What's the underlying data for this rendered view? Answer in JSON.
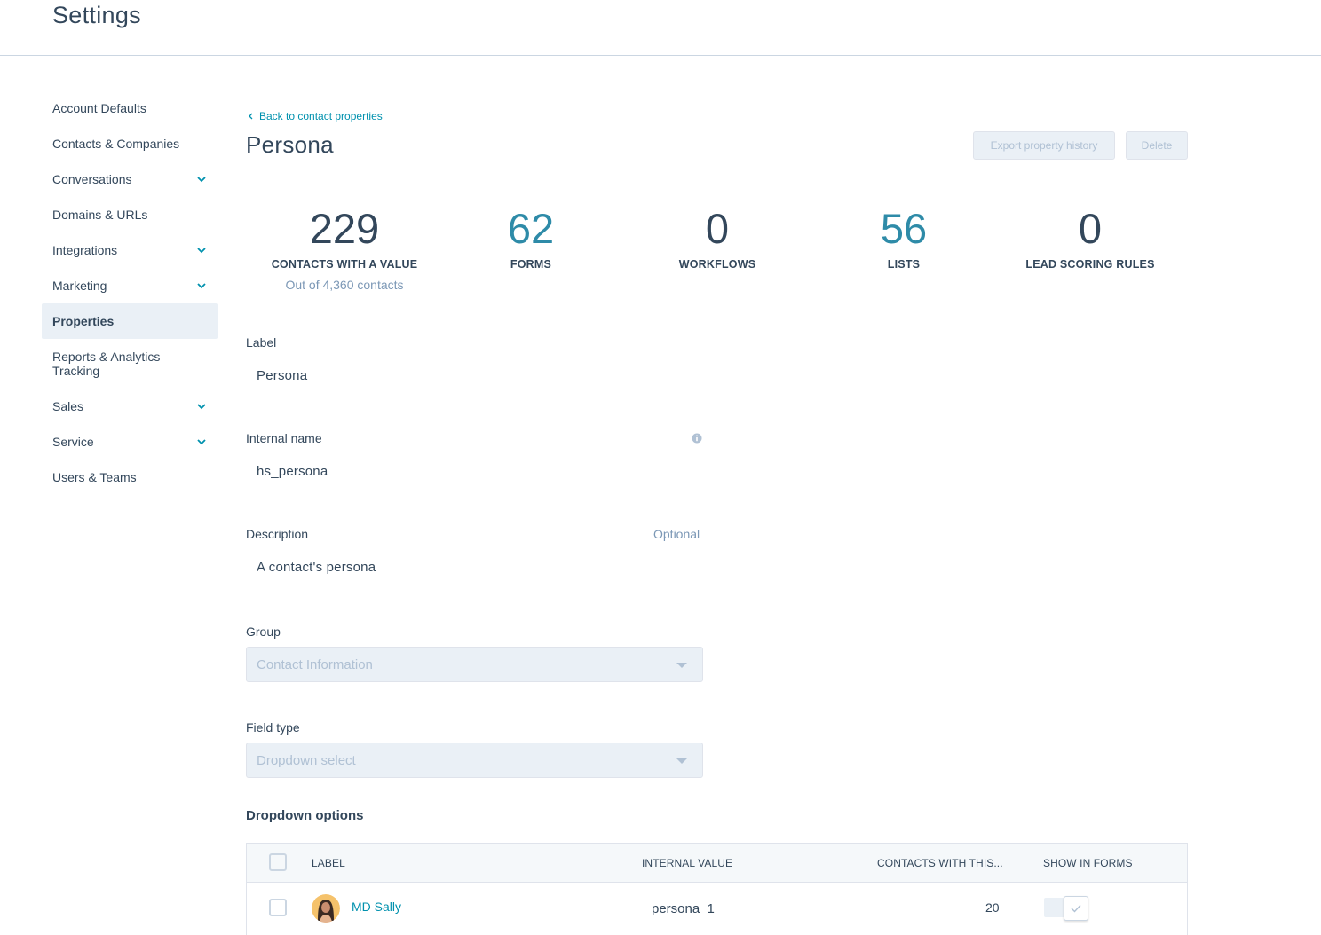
{
  "app": {
    "title": "Settings"
  },
  "sidebar": {
    "items": [
      {
        "label": "Account Defaults",
        "expandable": false
      },
      {
        "label": "Contacts & Companies",
        "expandable": false
      },
      {
        "label": "Conversations",
        "expandable": true
      },
      {
        "label": "Domains & URLs",
        "expandable": false
      },
      {
        "label": "Integrations",
        "expandable": true
      },
      {
        "label": "Marketing",
        "expandable": true
      },
      {
        "label": "Properties",
        "expandable": false,
        "active": true
      },
      {
        "label_line1": "Reports & Analytics",
        "label_line2": "Tracking",
        "expandable": false
      },
      {
        "label": "Sales",
        "expandable": true
      },
      {
        "label": "Service",
        "expandable": true
      },
      {
        "label": "Users & Teams",
        "expandable": false
      }
    ]
  },
  "property": {
    "back_link": "Back to contact properties",
    "title": "Persona",
    "export_button": "Export property history",
    "delete_button": "Delete"
  },
  "stats": [
    {
      "value": "229",
      "label": "CONTACTS WITH A VALUE",
      "sub": "Out of 4,360 contacts",
      "link": false
    },
    {
      "value": "62",
      "label": "FORMS",
      "link": true
    },
    {
      "value": "0",
      "label": "WORKFLOWS",
      "link": false
    },
    {
      "value": "56",
      "label": "LISTS",
      "link": true
    },
    {
      "value": "0",
      "label": "LEAD SCORING RULES",
      "link": false
    }
  ],
  "fields": {
    "label": {
      "label": "Label",
      "value": "Persona"
    },
    "internal_name": {
      "label": "Internal name",
      "value": "hs_persona"
    },
    "description": {
      "label": "Description",
      "optional": "Optional",
      "value": "A contact's persona"
    },
    "group": {
      "label": "Group",
      "value": "Contact Information"
    },
    "field_type": {
      "label": "Field type",
      "value": "Dropdown select"
    }
  },
  "dropdown_options": {
    "title": "Dropdown options",
    "columns": [
      "LABEL",
      "INTERNAL VALUE",
      "CONTACTS WITH THIS...",
      "SHOW IN FORMS"
    ],
    "rows": [
      {
        "label": "MD Sally",
        "internal_value": "persona_1",
        "contacts": "20",
        "show_in_forms": true
      }
    ]
  },
  "colors": {
    "text": "#33475b",
    "link": "#0091ae",
    "stat_link": "#2e8ba8",
    "muted": "#7c98b6",
    "disabled": "#b0c1d4",
    "active_bg": "#eaf0f6"
  }
}
